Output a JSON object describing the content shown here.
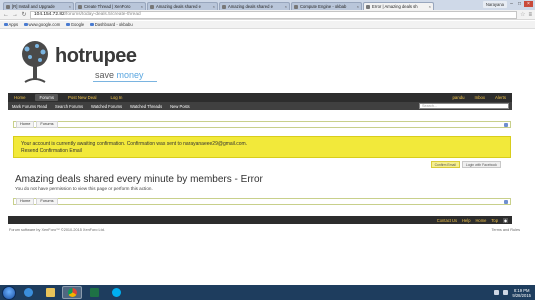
{
  "browser": {
    "tabs": [
      {
        "label": "[R] Install and Upgrade",
        "active": false
      },
      {
        "label": "Create Thread | XenForo",
        "active": false
      },
      {
        "label": "Amazing deals shared e",
        "active": false
      },
      {
        "label": "Amazing deals shared e",
        "active": false
      },
      {
        "label": "Compute Engine - okbab",
        "active": false
      },
      {
        "label": "Error | Amazing deals sh",
        "active": true
      }
    ],
    "profile_name": "Narayana",
    "url_host": "104.154.72.82",
    "url_path": "/forums/today-deals.5/create-thread",
    "bookmarks": [
      "Apps",
      "www.google.com",
      "Google",
      "Dashboard - okbabu"
    ]
  },
  "site": {
    "logo_word": "hotrupee",
    "tagline_save": "save",
    "tagline_money": "money",
    "nav": [
      "Home",
      "Forums",
      "Post New Deal",
      "Log In"
    ],
    "nav_active_index": 1,
    "nav_right": [
      "pandu",
      "Inbox",
      "Alerts"
    ],
    "subnav": [
      "Mark Forums Read",
      "Search Forums",
      "Watched Forums",
      "Watched Threads",
      "New Posts"
    ],
    "search_placeholder": "Search...",
    "breadcrumbs": [
      "Home",
      "Forums"
    ],
    "notice_line1": "Your account is currently awaiting confirmation. Confirmation was sent to narayanaeee29@gmail.com.",
    "notice_line2": "Resend Confirmation Email",
    "login_buttons": [
      "Confirm Email",
      "Login with Facebook"
    ],
    "page_title": "Amazing deals shared every minute by members - Error",
    "error_text": "You do not have permission to view this page or perform this action.",
    "footer_links": [
      "Contact Us",
      "Help",
      "Home"
    ],
    "footer_top": "Top",
    "copyright": "Forum software by XenForo™ ©2010-2015 XenForo Ltd.",
    "terms": "Terms and Rules"
  },
  "taskbar": {
    "time": "8:19 PM",
    "date": "9/28/2015",
    "apps": [
      "ie",
      "explorer",
      "chrome",
      "excel",
      "skype"
    ],
    "active_app": "chrome"
  }
}
